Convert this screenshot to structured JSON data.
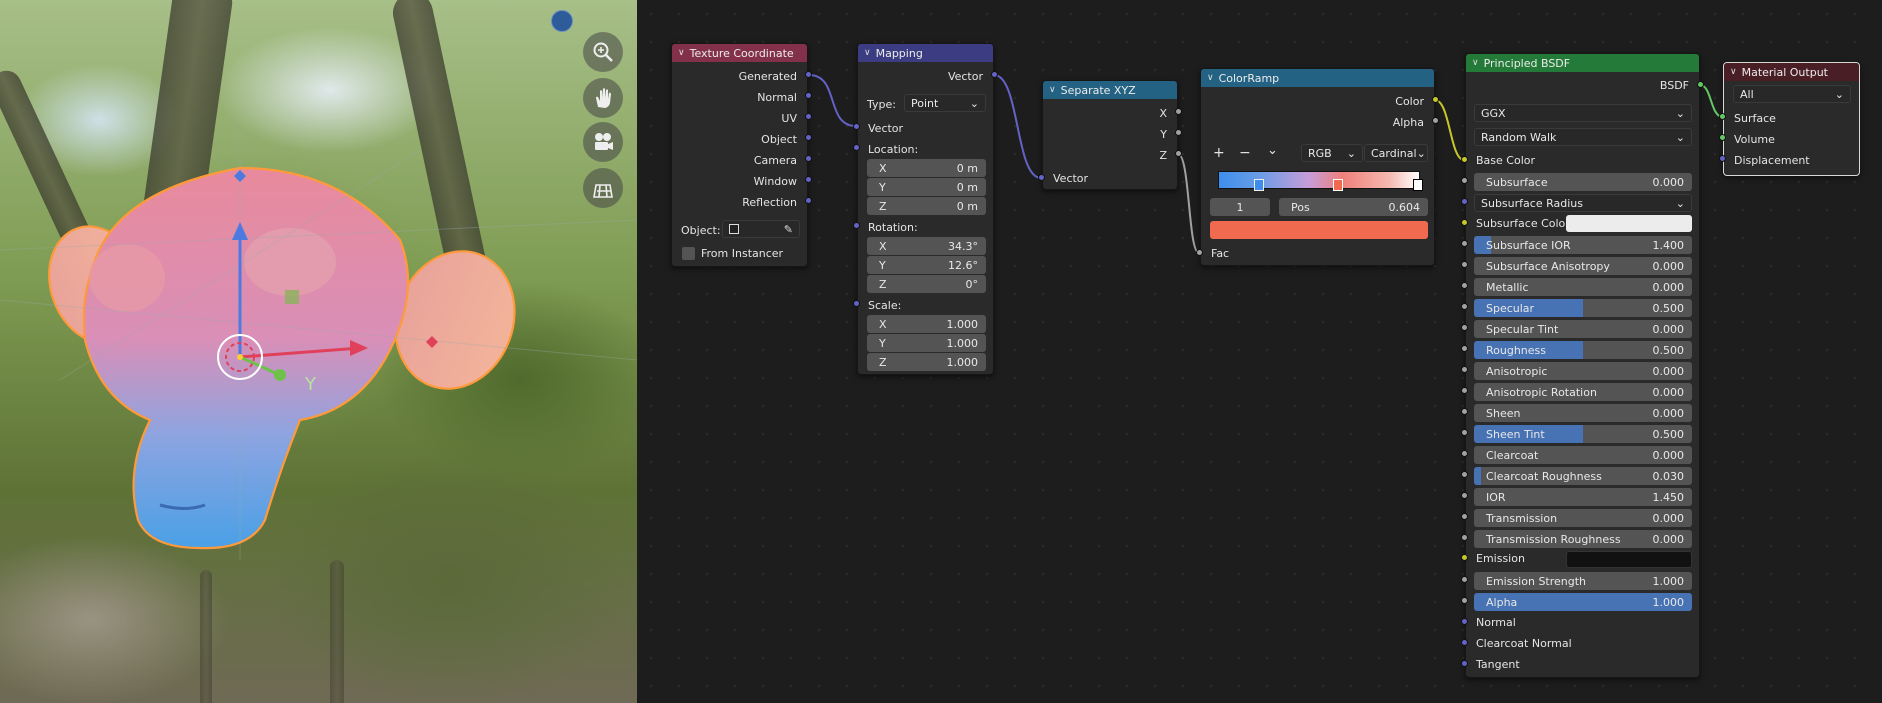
{
  "viewport": {
    "tools": [
      {
        "name": "zoom",
        "icon": "magnifier-plus-icon"
      },
      {
        "name": "pan",
        "icon": "hand-icon"
      },
      {
        "name": "camera",
        "icon": "camera-icon"
      },
      {
        "name": "ortho",
        "icon": "grid-icon"
      }
    ],
    "gizmo_labels": {
      "y": "Y"
    }
  },
  "nodes": {
    "texcoord": {
      "title": "Texture Coordinate",
      "outputs": [
        "Generated",
        "Normal",
        "UV",
        "Object",
        "Camera",
        "Window",
        "Reflection"
      ],
      "object_label": "Object:",
      "from_instancer": "From Instancer"
    },
    "mapping": {
      "title": "Mapping",
      "output": "Vector",
      "type_label": "Type:",
      "type_value": "Point",
      "vector_in": "Vector",
      "location_label": "Location:",
      "location": [
        {
          "axis": "X",
          "value": "0 m"
        },
        {
          "axis": "Y",
          "value": "0 m"
        },
        {
          "axis": "Z",
          "value": "0 m"
        }
      ],
      "rotation_label": "Rotation:",
      "rotation": [
        {
          "axis": "X",
          "value": "34.3°"
        },
        {
          "axis": "Y",
          "value": "12.6°"
        },
        {
          "axis": "Z",
          "value": "0°"
        }
      ],
      "scale_label": "Scale:",
      "scale": [
        {
          "axis": "X",
          "value": "1.000"
        },
        {
          "axis": "Y",
          "value": "1.000"
        },
        {
          "axis": "Z",
          "value": "1.000"
        }
      ]
    },
    "sepxyz": {
      "title": "Separate XYZ",
      "outputs": [
        "X",
        "Y",
        "Z"
      ],
      "input": "Vector"
    },
    "colorramp": {
      "title": "ColorRamp",
      "outputs": [
        "Color",
        "Alpha"
      ],
      "add": "+",
      "remove": "−",
      "more": "⌄",
      "mode": "RGB",
      "interp": "Cardinal",
      "index": "1",
      "pos_label": "Pos",
      "pos_value": "0.604",
      "swatch_color": "#f06a4f",
      "input": "Fac"
    },
    "bsdf": {
      "title": "Principled BSDF",
      "output": "BSDF",
      "distribution": "GGX",
      "sss_method": "Random Walk",
      "base_color": "Base Color",
      "subsurface": {
        "label": "Subsurface",
        "value": "0.000"
      },
      "subsurface_radius": "Subsurface Radius",
      "subsurface_color": "Subsurface Color",
      "params": [
        {
          "label": "Subsurface IOR",
          "value": "1.400",
          "fill": 0.08
        },
        {
          "label": "Subsurface Anisotropy",
          "value": "0.000",
          "fill": 0
        },
        {
          "label": "Metallic",
          "value": "0.000",
          "fill": 0
        },
        {
          "label": "Specular",
          "value": "0.500",
          "fill": 0.5
        },
        {
          "label": "Specular Tint",
          "value": "0.000",
          "fill": 0
        },
        {
          "label": "Roughness",
          "value": "0.500",
          "fill": 0.5
        },
        {
          "label": "Anisotropic",
          "value": "0.000",
          "fill": 0
        },
        {
          "label": "Anisotropic Rotation",
          "value": "0.000",
          "fill": 0
        },
        {
          "label": "Sheen",
          "value": "0.000",
          "fill": 0
        },
        {
          "label": "Sheen Tint",
          "value": "0.500",
          "fill": 0.5
        },
        {
          "label": "Clearcoat",
          "value": "0.000",
          "fill": 0
        },
        {
          "label": "Clearcoat Roughness",
          "value": "0.030",
          "fill": 0.03
        },
        {
          "label": "IOR",
          "value": "1.450",
          "fill": 0
        },
        {
          "label": "Transmission",
          "value": "0.000",
          "fill": 0
        },
        {
          "label": "Transmission Roughness",
          "value": "0.000",
          "fill": 0
        }
      ],
      "emission": "Emission",
      "emission_strength": {
        "label": "Emission Strength",
        "value": "1.000"
      },
      "alpha": {
        "label": "Alpha",
        "value": "1.000"
      },
      "normal": "Normal",
      "clearcoat_normal": "Clearcoat Normal",
      "tangent": "Tangent"
    },
    "output": {
      "title": "Material Output",
      "target": "All",
      "inputs": [
        "Surface",
        "Volume",
        "Displacement"
      ]
    }
  },
  "colors": {
    "texcoord_header": "#83314a",
    "mapping_header": "#3c3c83",
    "converter_header": "#246283",
    "shader_header": "#247a38",
    "output_header": "#4a1e25",
    "value_fill": "#4772b3"
  }
}
